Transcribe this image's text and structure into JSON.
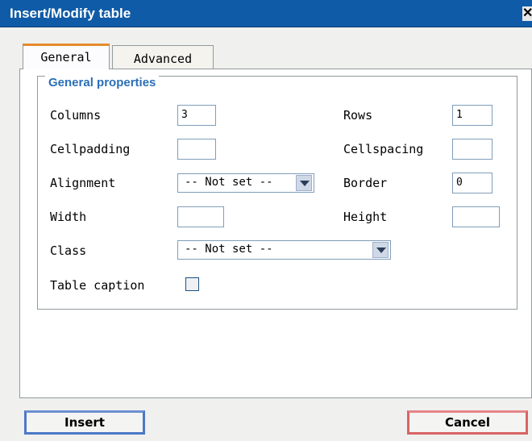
{
  "dialog": {
    "title": "Insert/Modify table",
    "close_glyph": "✕"
  },
  "tabs": [
    {
      "label": "General",
      "active": true
    },
    {
      "label": "Advanced",
      "active": false
    }
  ],
  "general": {
    "legend": "General properties",
    "columns": {
      "label": "Columns",
      "value": "3"
    },
    "rows": {
      "label": "Rows",
      "value": "1"
    },
    "cellpadding": {
      "label": "Cellpadding",
      "value": ""
    },
    "cellspacing": {
      "label": "Cellspacing",
      "value": ""
    },
    "alignment": {
      "label": "Alignment",
      "value": "-- Not set --"
    },
    "border": {
      "label": "Border",
      "value": "0"
    },
    "width": {
      "label": "Width",
      "value": ""
    },
    "height": {
      "label": "Height",
      "value": ""
    },
    "class": {
      "label": "Class",
      "value": "-- Not set --"
    },
    "caption": {
      "label": "Table caption",
      "checked": false
    }
  },
  "buttons": {
    "insert": "Insert",
    "cancel": "Cancel"
  },
  "colors": {
    "titlebar": "#0f5ba7",
    "active_tab_accent": "#e68b2c",
    "legend_text": "#2b6fb6",
    "insert_border": "#4d78c6",
    "cancel_border": "#d86465"
  },
  "icons": {
    "close": "close-icon",
    "dropdown": "chevron-down-icon"
  }
}
